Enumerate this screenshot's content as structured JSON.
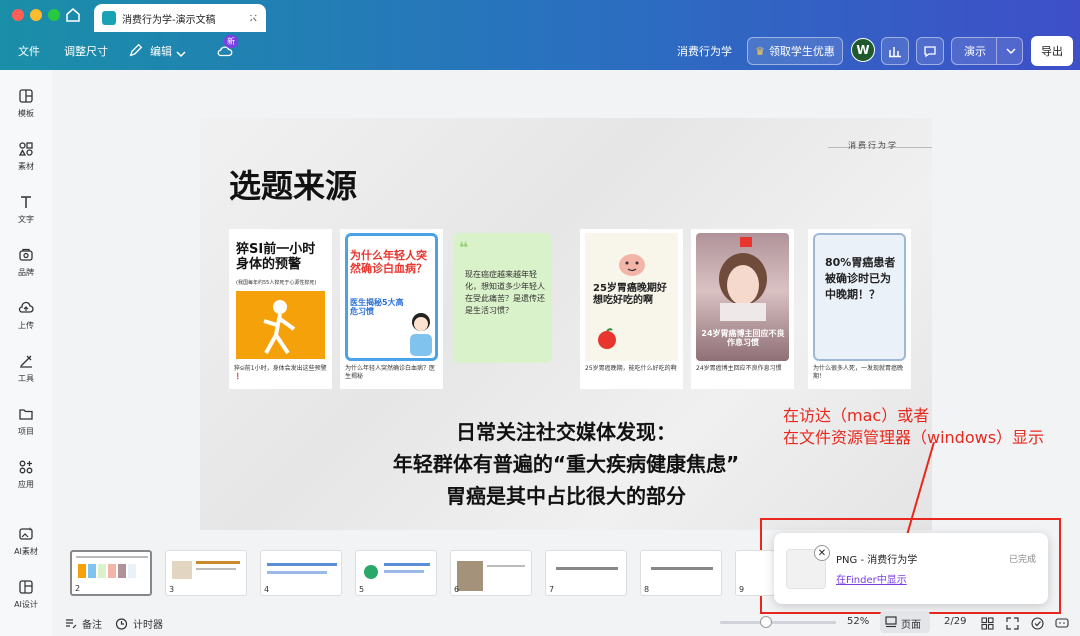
{
  "window": {
    "tab_title": "消费行为学-演示文稿",
    "new_tab_icon": "plus-icon"
  },
  "toolbar": {
    "file": "文件",
    "resize": "调整尺寸",
    "edit": "编辑",
    "new_badge": "新",
    "doc_name": "消费行为学",
    "student_offer": "领取学生优惠",
    "avatar_letter": "W",
    "present": "演示",
    "export": "导出"
  },
  "sidebar": {
    "items": [
      {
        "label": "模板",
        "icon": "template-icon"
      },
      {
        "label": "素材",
        "icon": "elements-icon"
      },
      {
        "label": "文字",
        "icon": "text-icon"
      },
      {
        "label": "品牌",
        "icon": "brand-icon"
      },
      {
        "label": "上传",
        "icon": "upload-icon"
      },
      {
        "label": "工具",
        "icon": "tools-icon"
      },
      {
        "label": "项目",
        "icon": "folder-icon"
      },
      {
        "label": "应用",
        "icon": "apps-icon"
      },
      {
        "label": "AI素材",
        "icon": "ai-image-icon"
      },
      {
        "label": "AI设计",
        "icon": "ai-design-icon"
      }
    ]
  },
  "slide": {
    "topic": "消费行为学",
    "title": "选题来源",
    "cards": [
      {
        "headline": "猝SI前一小时身体的预警",
        "sub": "(我国每年约55人猝死于心源性猝死)",
        "caption": "猝si前1小时，身体会发出这些预警❗"
      },
      {
        "headline": "为什么年轻人突然确诊白血病？",
        "sub": "医生揭秘5大高危习惯",
        "caption": "为什么年轻人突然确诊白血病？医生揭秘"
      },
      {
        "headline": "现在癌症越来越年轻化，想知道多少年轻人在受此痛苦？是遗传还是生活习惯？",
        "sub": "",
        "caption": ""
      },
      {
        "headline": "25岁胃癌晚期好想吃好吃的啊",
        "sub": "",
        "caption": "25岁胃癌晚期，能吃什么好吃的啊"
      },
      {
        "headline": "24岁胃癌博主回应不良作息习惯",
        "sub": "",
        "caption": "24岁胃癌博主回应不良作息习惯"
      },
      {
        "headline": "80%胃癌患者被确诊时已为中晚期！？",
        "sub": "",
        "caption": "为什么很多人死，一发现就胃癌晚期！"
      }
    ],
    "line1": "日常关注社交媒体发现：",
    "line2": "年轻群体有普遍的“重大疾病健康焦虑”",
    "line3": "胃癌是其中占比很大的部分"
  },
  "annotation": {
    "line1": "在访达（mac）或者",
    "line2": "在文件资源管理器（windows）显示"
  },
  "filmstrip": {
    "numbers": [
      "2",
      "3",
      "4",
      "5",
      "6",
      "7",
      "8",
      "9"
    ]
  },
  "notification": {
    "title": "PNG - 消费行为学",
    "status": "已完成",
    "link": "在Finder中显示"
  },
  "statusbar": {
    "notes": "备注",
    "timer": "计时器",
    "zoom": "52%",
    "view": "页面",
    "page": "2/29"
  },
  "colors": {
    "accent_teal": "#1a8fa8",
    "accent_indigo": "#3e4fc8",
    "annotation_red": "#e8281e",
    "link_purple": "#7b3fe4"
  }
}
